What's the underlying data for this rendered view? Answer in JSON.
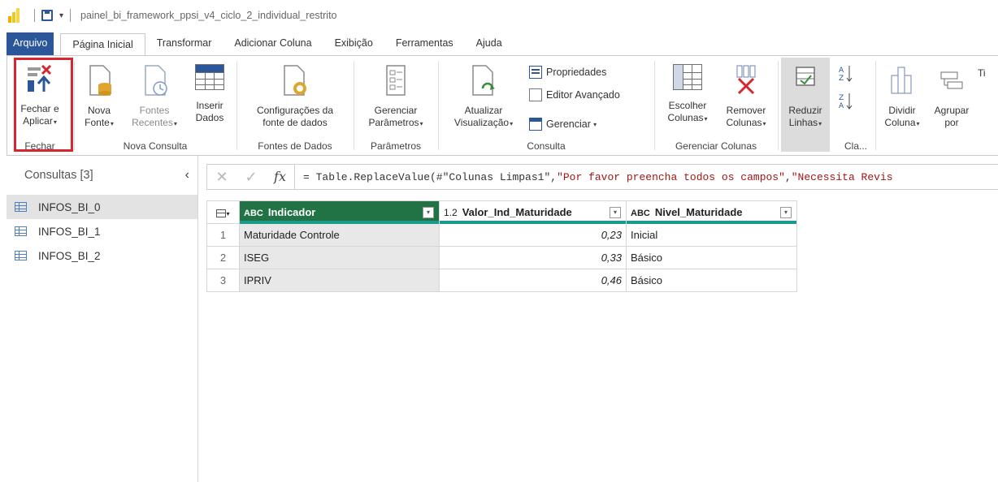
{
  "title_bar": {
    "file_name": "painel_bi_framework_ppsi_v4_ciclo_2_individual_restrito"
  },
  "tabs": [
    {
      "label": "Arquivo",
      "state": "file"
    },
    {
      "label": "Página Inicial",
      "state": "active"
    },
    {
      "label": "Transformar",
      "state": ""
    },
    {
      "label": "Adicionar Coluna",
      "state": ""
    },
    {
      "label": "Exibição",
      "state": ""
    },
    {
      "label": "Ferramentas",
      "state": ""
    },
    {
      "label": "Ajuda",
      "state": ""
    }
  ],
  "ribbon": {
    "fechar": {
      "btn_line1": "Fechar e",
      "btn_line2": "Aplicar",
      "group": "Fechar"
    },
    "nova_consulta": {
      "nova_fonte": [
        "Nova",
        "Fonte"
      ],
      "fontes_recentes": [
        "Fontes",
        "Recentes"
      ],
      "inserir_dados": [
        "Inserir",
        "Dados"
      ],
      "group": "Nova Consulta"
    },
    "fontes_dados": {
      "btn": [
        "Configurações da",
        "fonte de dados"
      ],
      "group": "Fontes de Dados"
    },
    "parametros": {
      "btn": [
        "Gerenciar",
        "Parâmetros"
      ],
      "group": "Parâmetros"
    },
    "consulta": {
      "atualizar": [
        "Atualizar",
        "Visualização"
      ],
      "propriedades": "Propriedades",
      "editor_avancado": "Editor Avançado",
      "gerenciar": "Gerenciar",
      "group": "Consulta"
    },
    "gerenciar_colunas": {
      "escolher": [
        "Escolher",
        "Colunas"
      ],
      "remover": [
        "Remover",
        "Colunas"
      ],
      "group": "Gerenciar Colunas"
    },
    "reduzir": {
      "btn": [
        "Reduzir",
        "Linhas"
      ],
      "group": "Cla..."
    },
    "transformar": {
      "dividir": [
        "Dividir",
        "Coluna"
      ],
      "agrupar": [
        "Agrupar",
        "por"
      ],
      "ti": "Ti"
    }
  },
  "queries_pane": {
    "header": "Consultas [3]",
    "items": [
      "INFOS_BI_0",
      "INFOS_BI_1",
      "INFOS_BI_2"
    ],
    "active_index": 0
  },
  "formula": {
    "fx": "fx",
    "prefix": "= Table.ReplaceValue(#\"Colunas Limpas1\",",
    "str1": "\"Por favor preencha todos os campos\"",
    "comma": ",",
    "str2": "\"Necessita Revis"
  },
  "table": {
    "columns": [
      {
        "type": "ABC",
        "name": "Indicador"
      },
      {
        "type": "1.2",
        "name": "Valor_Ind_Maturidade"
      },
      {
        "type": "ABC",
        "name": "Nivel_Maturidade"
      }
    ],
    "rows": [
      {
        "n": "1",
        "indicador": "Maturidade Controle",
        "valor": "0,23",
        "nivel": "Inicial"
      },
      {
        "n": "2",
        "indicador": "ISEG",
        "valor": "0,33",
        "nivel": "Básico"
      },
      {
        "n": "3",
        "indicador": "IPRIV",
        "valor": "0,46",
        "nivel": "Básico"
      }
    ]
  }
}
